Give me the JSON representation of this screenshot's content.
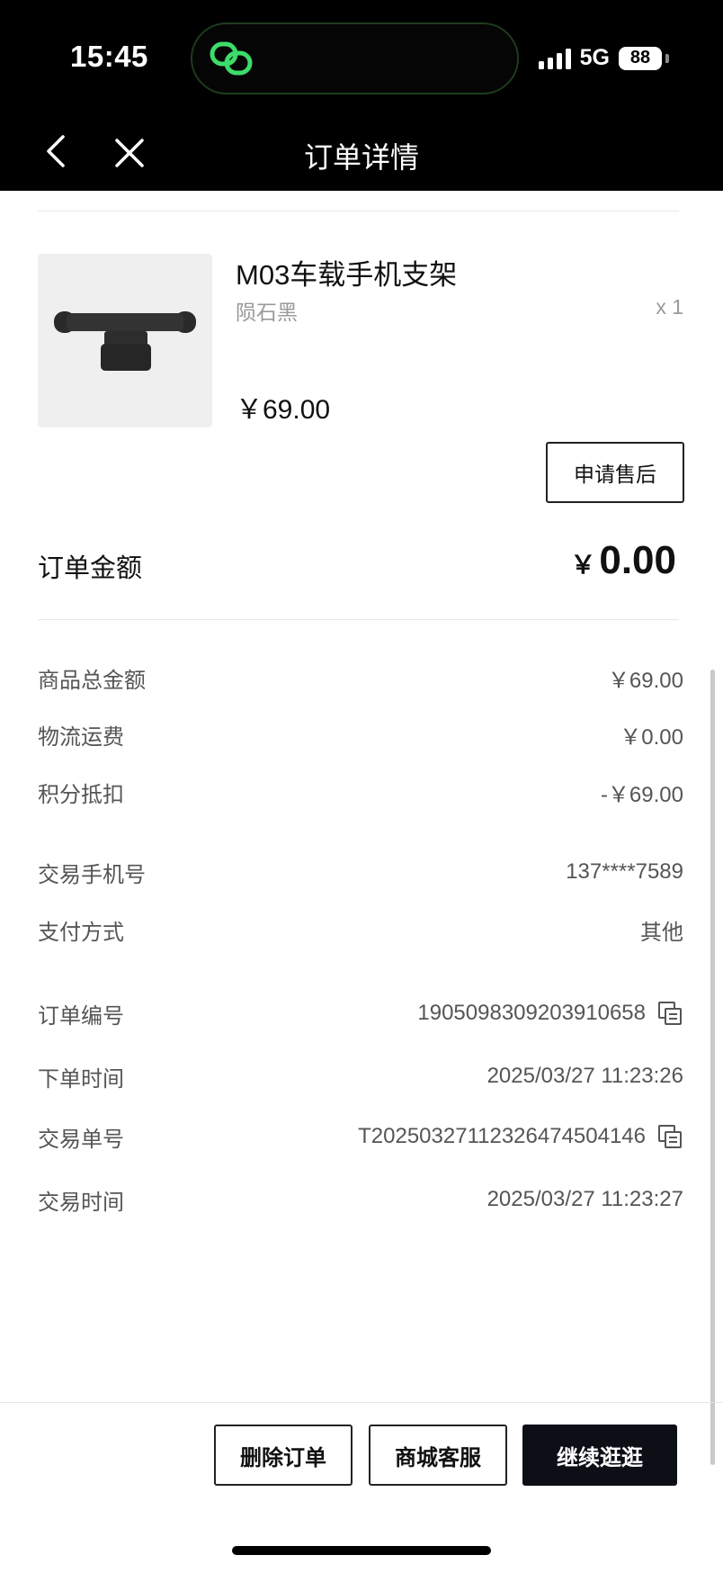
{
  "status_bar": {
    "time": "15:45",
    "network": "5G",
    "battery": "88"
  },
  "nav": {
    "title": "订单详情"
  },
  "product": {
    "name": "M03车载手机支架",
    "variant": "陨石黑",
    "quantity": "x 1",
    "price": "￥69.00",
    "after_sale_label": "申请售后"
  },
  "order_amount": {
    "label": "订单金额",
    "symbol": "￥",
    "value": "0.00"
  },
  "summary": [
    {
      "label": "商品总金额",
      "value": "￥69.00"
    },
    {
      "label": "物流运费",
      "value": "￥0.00"
    },
    {
      "label": "积分抵扣",
      "value": "-￥69.00"
    }
  ],
  "payment": [
    {
      "label": "交易手机号",
      "value": "137****7589"
    },
    {
      "label": "支付方式",
      "value": "其他"
    }
  ],
  "order_info": [
    {
      "label": "订单编号",
      "value": "1905098309203910658"
    },
    {
      "label": "下单时间",
      "value": "2025/03/27 11:23:26"
    },
    {
      "label": "交易单号",
      "value": "T2025032711232647450414​6"
    },
    {
      "label": "交易时间",
      "value": "2025/03/27 11:23:27"
    }
  ],
  "actions": {
    "delete": "删除订单",
    "service": "商城客服",
    "continue": "继续逛逛"
  }
}
